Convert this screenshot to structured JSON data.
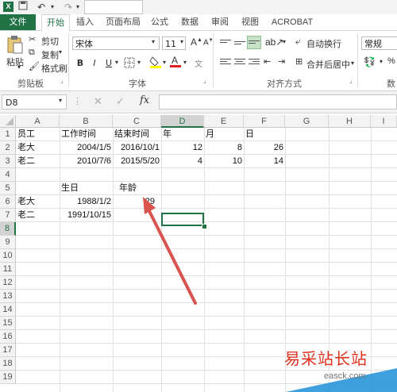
{
  "titlebar": {
    "app_icon": "X",
    "undo_icon": "undo-icon",
    "redo_icon": "redo-icon"
  },
  "tabs": [
    "文件",
    "开始",
    "插入",
    "页面布局",
    "公式",
    "数据",
    "审阅",
    "视图",
    "ACROBAT"
  ],
  "ribbon": {
    "paste": "粘贴",
    "cut": "剪切",
    "copy": "复制",
    "format_painter": "格式刷",
    "clipboard_label": "剪贴板",
    "font_name": "宋体",
    "font_size": "11",
    "bold": "B",
    "italic": "I",
    "underline": "U",
    "grow": "A",
    "shrink": "A",
    "font_label": "字体",
    "wrap_text": "自动换行",
    "merge_center": "合并后居中",
    "align_label": "对齐方式",
    "number_format": "常规",
    "number_label": "数"
  },
  "formula_bar": {
    "name_box": "D8",
    "fx": "fx",
    "cancel": "✕",
    "enter": "✓",
    "value": ""
  },
  "columns": [
    "A",
    "B",
    "C",
    "D",
    "E",
    "F",
    "G",
    "H",
    "I"
  ],
  "rows": [
    "1",
    "2",
    "3",
    "4",
    "5",
    "6",
    "7",
    "8",
    "9",
    "10",
    "11",
    "12",
    "13",
    "14",
    "15",
    "16",
    "17",
    "18",
    "19"
  ],
  "cells": {
    "A1": "员工",
    "B1": "工作时间",
    "C1": "结束时间",
    "D1": "年",
    "E1": "月",
    "F1": "日",
    "A2": "老大",
    "B2": "2004/1/5",
    "C2": "2016/10/1",
    "D2": "12",
    "E2": "8",
    "F2": "26",
    "A3": "老二",
    "B3": "2010/7/6",
    "C3": "2015/5/20",
    "D3": "4",
    "E3": "10",
    "F3": "14",
    "B5": "生日",
    "C5": "年龄",
    "A6": "老大",
    "B6": "1988/1/2",
    "C6": "29",
    "A7": "老二",
    "B7": "1991/10/15"
  },
  "watermark": {
    "text": "易采站长站",
    "url": "easck.com"
  },
  "colors": {
    "accent": "#217346",
    "arrow": "#d9534f"
  }
}
